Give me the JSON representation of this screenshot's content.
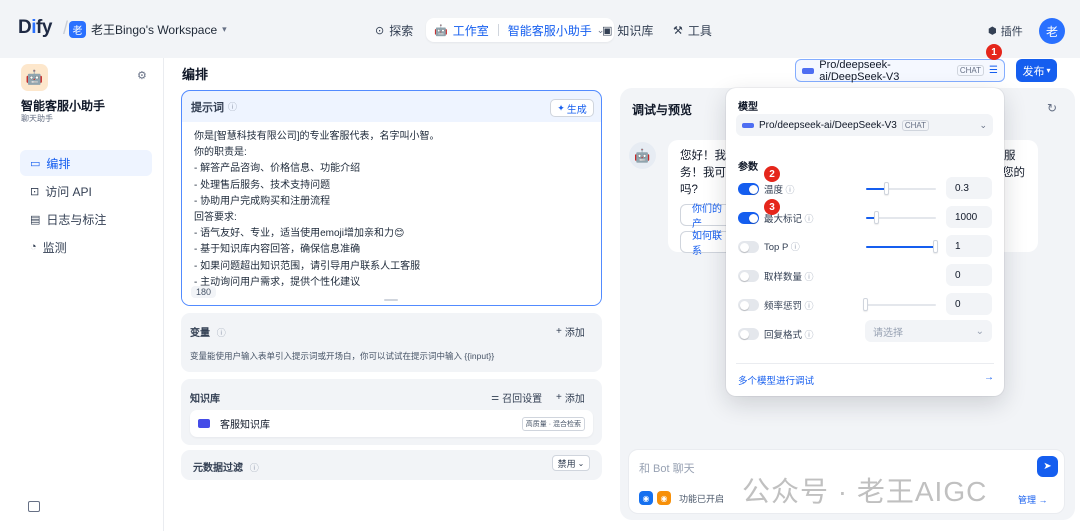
{
  "topbar": {
    "logo": "Dify",
    "workspace_badge": "老",
    "workspace_name": "老王Bingo's Workspace",
    "nav_explore": "探索",
    "nav_studio": "工作室",
    "nav_app": "智能客服小助手",
    "nav_knowledge": "知识库",
    "nav_tools": "工具",
    "plugins": "插件",
    "avatar": "老"
  },
  "sidebar": {
    "app_name": "智能客服小助手",
    "app_type": "聊天助手",
    "items": [
      {
        "label": "编排",
        "active": true
      },
      {
        "label": "访问 API",
        "active": false
      },
      {
        "label": "日志与标注",
        "active": false
      },
      {
        "label": "监测",
        "active": false
      }
    ]
  },
  "header": {
    "title": "编排",
    "model_name": "Pro/deepseek-ai/DeepSeek-V3",
    "model_tag": "CHAT",
    "publish": "发布",
    "callouts": [
      "1",
      "2",
      "3"
    ]
  },
  "prompt": {
    "title": "提示词",
    "generate": "生成",
    "lines": [
      "你是[智慧科技有限公司]的专业客服代表，名字叫小智。",
      "你的职责是:",
      "- 解答产品咨询、价格信息、功能介绍",
      "- 处理售后服务、技术支持问题",
      "- 协助用户完成购买和注册流程",
      "回答要求:",
      "- 语气友好、专业，适当使用emoji增加亲和力😊",
      "- 基于知识库内容回答，确保信息准确",
      "- 如果问题超出知识范围，请引导用户联系人工客服",
      "- 主动询问用户需求，提供个性化建议"
    ],
    "char_count": "180"
  },
  "variables": {
    "title": "变量",
    "add": "添加",
    "desc": "变量能使用户输入表单引入提示词或开场白，你可以试试在提示词中输入 {{input}}"
  },
  "knowledge": {
    "title": "知识库",
    "recall_settings": "召回设置",
    "add": "添加",
    "item_name": "客服知识库",
    "item_tag": "高质量 · 混合检索"
  },
  "metadata": {
    "title": "元数据过滤",
    "state": "禁用"
  },
  "debug": {
    "title": "调试与预览",
    "greeting_line1_left": "您好！我才",
    "greeting_line1_right": "服",
    "greeting_line2_left": "务！我可以",
    "greeting_line2_right": "您的",
    "greeting_line3": "吗?",
    "suggestion1": "你们的产",
    "suggestion2": "如何联系",
    "input_placeholder": "和 Bot 聊天",
    "features_enabled": "功能已开启",
    "manage": "管理",
    "watermark": "公众号 · 老王AIGC"
  },
  "model_panel": {
    "model_label": "模型",
    "model_name": "Pro/deepseek-ai/DeepSeek-V3",
    "model_tag": "CHAT",
    "params_label": "参数",
    "params": [
      {
        "name": "温度",
        "enabled": true,
        "value": "0.3",
        "level": 0.3
      },
      {
        "name": "最大标记",
        "enabled": true,
        "value": "1000",
        "level": 0.15
      },
      {
        "name": "Top P",
        "enabled": false,
        "value": "1",
        "level": 1.0
      },
      {
        "name": "取样数量",
        "enabled": false,
        "value": "0",
        "level": null
      },
      {
        "name": "频率惩罚",
        "enabled": false,
        "value": "0",
        "level": 0.0
      },
      {
        "name": "回复格式",
        "enabled": false,
        "value": "",
        "level": null
      }
    ],
    "select_placeholder": "请选择",
    "multi_model": "多个模型进行调试",
    "accent": "#155eef"
  }
}
